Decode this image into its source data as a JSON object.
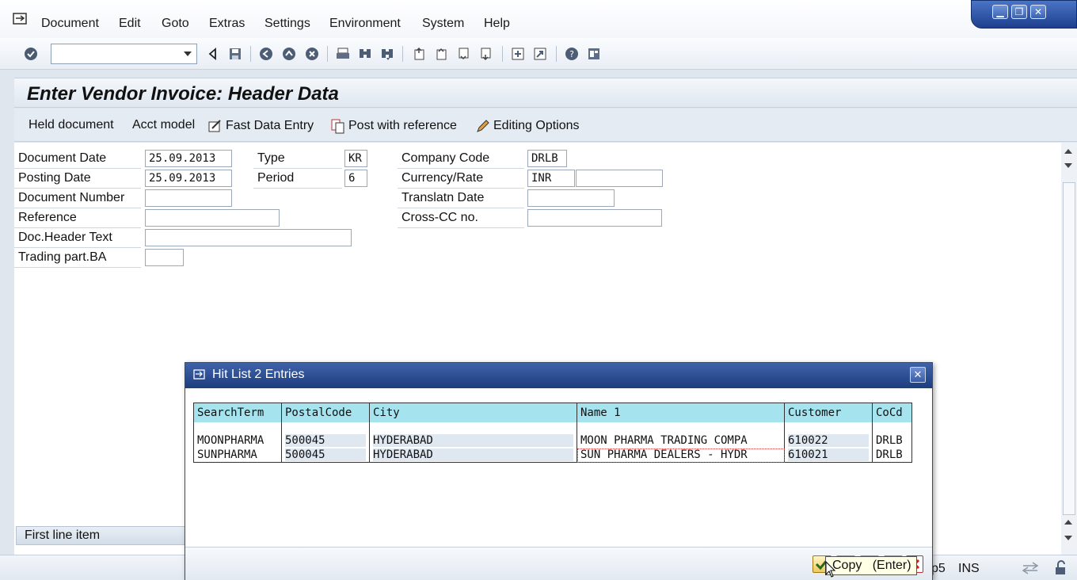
{
  "menu": {
    "items": [
      "Document",
      "Edit",
      "Goto",
      "Extras",
      "Settings",
      "Environment",
      "System",
      "Help"
    ]
  },
  "toolbar": {
    "command_field_value": ""
  },
  "screen": {
    "title": "Enter Vendor Invoice: Header Data"
  },
  "app_toolbar": {
    "held_document": "Held document",
    "acct_model": "Acct model",
    "fast_data_entry": "Fast Data Entry",
    "post_with_reference": "Post with reference",
    "editing_options": "Editing Options"
  },
  "form": {
    "document_date": {
      "label": "Document Date",
      "value": "25.09.2013"
    },
    "posting_date": {
      "label": "Posting Date",
      "value": "25.09.2013"
    },
    "document_number": {
      "label": "Document Number",
      "value": ""
    },
    "reference": {
      "label": "Reference",
      "value": ""
    },
    "doc_header_text": {
      "label": "Doc.Header Text",
      "value": ""
    },
    "trading_part_ba": {
      "label": "Trading part.BA",
      "value": ""
    },
    "type": {
      "label": "Type",
      "value": "KR"
    },
    "period": {
      "label": "Period",
      "value": "6"
    },
    "company_code": {
      "label": "Company Code",
      "value": "DRLB"
    },
    "currency_rate": {
      "label": "Currency/Rate",
      "value": "INR",
      "rate": ""
    },
    "translatn_date": {
      "label": "Translatn Date",
      "value": ""
    },
    "cross_cc_no": {
      "label": "Cross-CC no.",
      "value": ""
    }
  },
  "first_line_item": "First line item",
  "dialog": {
    "title": "Hit List 2 Entries",
    "columns": [
      "SearchTerm",
      "PostalCode",
      "City",
      "Name 1",
      "Customer",
      "CoCd"
    ],
    "rows": [
      [
        "MOONPHARMA",
        "500045",
        "HYDERABAD",
        "MOON PHARMA TRADING COMPA",
        "610022",
        "DRLB"
      ],
      [
        "SUNPHARMA",
        "500045",
        "HYDERABAD",
        "SUN PHARMA DEALERS - HYDR",
        "610021",
        "DRLB"
      ]
    ],
    "tooltip": "Copy   (Enter)"
  },
  "status": {
    "server": "p5",
    "mode": "INS"
  }
}
